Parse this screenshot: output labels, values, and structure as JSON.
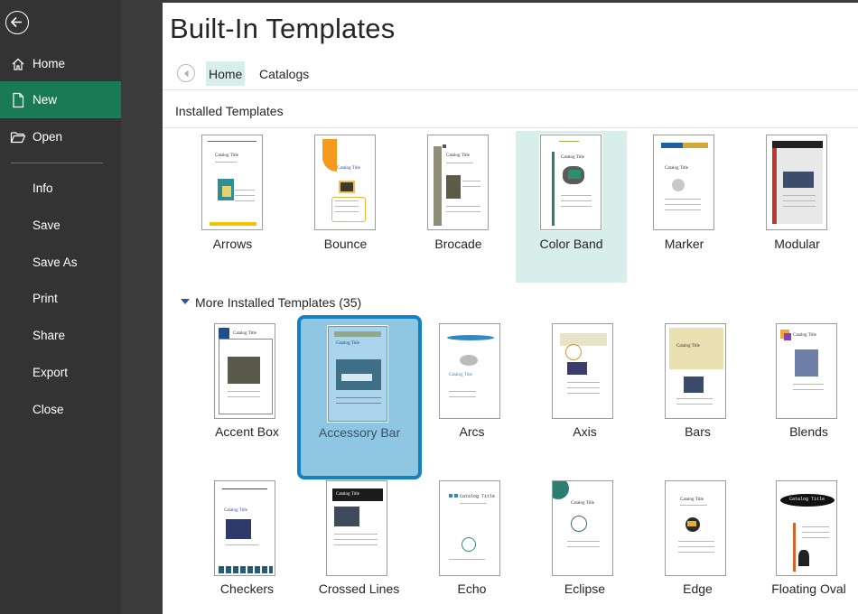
{
  "rail": {
    "items": [
      {
        "label": "Home"
      },
      {
        "label": "New"
      },
      {
        "label": "Open"
      },
      {
        "label": "Info"
      },
      {
        "label": "Save"
      },
      {
        "label": "Save As"
      },
      {
        "label": "Print"
      },
      {
        "label": "Share"
      },
      {
        "label": "Export"
      },
      {
        "label": "Close"
      }
    ],
    "active": "New"
  },
  "header": {
    "title": "Built-In Templates"
  },
  "tabs": [
    {
      "label": "Home"
    },
    {
      "label": "Catalogs"
    }
  ],
  "installed": {
    "title": "Installed Templates",
    "templates": [
      {
        "label": "Arrows"
      },
      {
        "label": "Bounce"
      },
      {
        "label": "Brocade"
      },
      {
        "label": "Color Band"
      },
      {
        "label": "Marker"
      },
      {
        "label": "Modular"
      }
    ]
  },
  "more": {
    "title": "More Installed Templates (35)",
    "templates": [
      {
        "label": "Accent Box"
      },
      {
        "label": "Accessory Bar"
      },
      {
        "label": "Arcs"
      },
      {
        "label": "Axis"
      },
      {
        "label": "Bars"
      },
      {
        "label": "Blends"
      },
      {
        "label": "Checkers"
      },
      {
        "label": "Crossed Lines"
      },
      {
        "label": "Echo"
      },
      {
        "label": "Eclipse"
      },
      {
        "label": "Edge"
      },
      {
        "label": "Floating Oval"
      }
    ]
  },
  "thumb_text": {
    "catalog_title": "Catalog Title",
    "catalog_title_mono": "Catalog Title"
  },
  "colors": {
    "rail": "#333333",
    "active": "#1b7a56",
    "tab_active": "#d8eeea",
    "selected_tile": "#8fc6e2",
    "selected_border": "#1680c6"
  }
}
